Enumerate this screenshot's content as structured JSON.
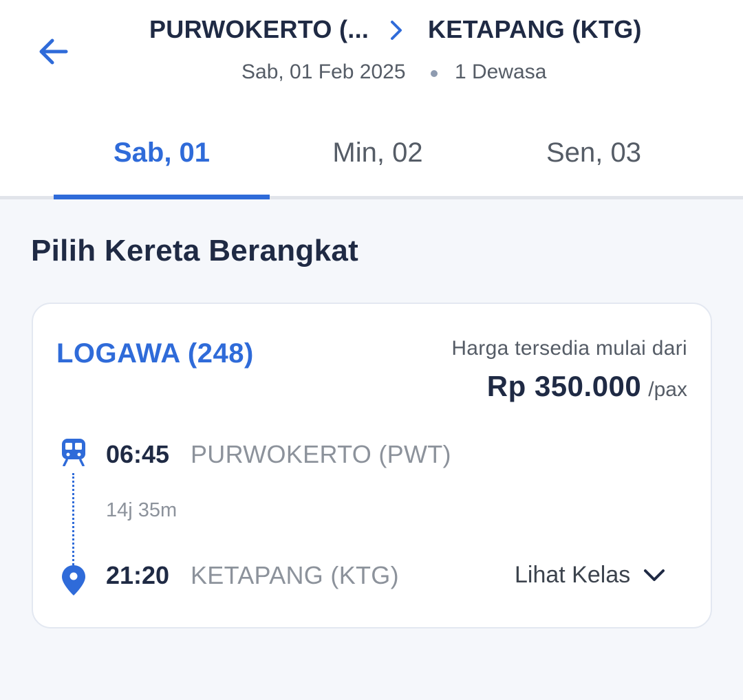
{
  "header": {
    "origin": "PURWOKERTO (...",
    "destination": "KETAPANG (KTG)",
    "date": "Sab, 01 Feb 2025",
    "passengers": "1 Dewasa"
  },
  "tabs": [
    {
      "label": "Sab, 01",
      "active": true
    },
    {
      "label": "Min, 02",
      "active": false
    },
    {
      "label": "Sen, 03",
      "active": false
    }
  ],
  "section_title": "Pilih Kereta Berangkat",
  "train": {
    "name": "LOGAWA (248)",
    "price_caption": "Harga tersedia mulai dari",
    "price": "Rp 350.000",
    "per": "/pax",
    "departure": {
      "time": "06:45",
      "station": "PURWOKERTO (PWT)"
    },
    "duration": "14j 35m",
    "arrival": {
      "time": "21:20",
      "station": "KETAPANG (KTG)"
    },
    "view_class_label": "Lihat Kelas"
  },
  "colors": {
    "accent": "#2f6bd9",
    "text": "#1f2a44",
    "muted": "#8c929b"
  },
  "icons": [
    "back-arrow-icon",
    "chevron-right-icon",
    "train-icon",
    "location-pin-icon",
    "chevron-down-icon"
  ]
}
